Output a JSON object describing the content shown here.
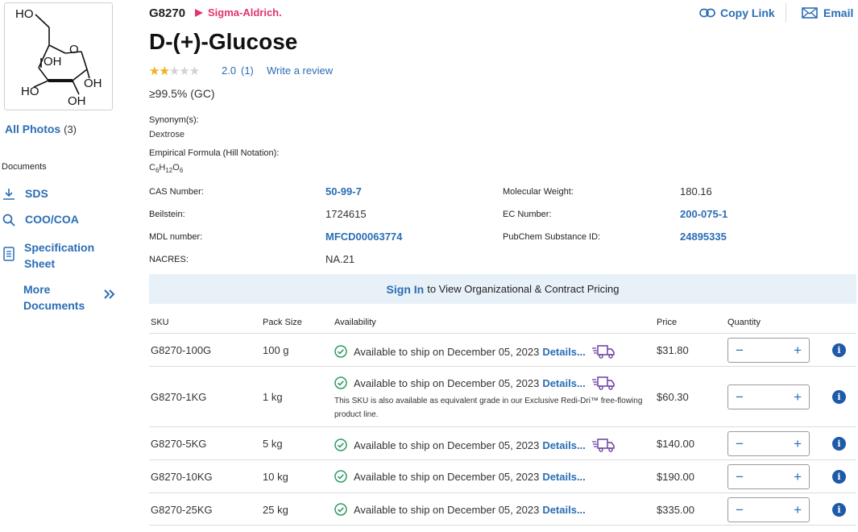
{
  "photos": {
    "label": "All Photos",
    "count": "(3)"
  },
  "documents": {
    "heading": "Documents",
    "items": [
      "SDS",
      "COO/COA"
    ],
    "spec_line1": "Specification",
    "spec_line2": "Sheet",
    "more_line1": "More",
    "more_line2": "Documents"
  },
  "header": {
    "sku": "G8270",
    "brand": "Sigma-Aldrich.",
    "title": "D-(+)-Glucose",
    "rating": 2.0,
    "rating_text": "2.0",
    "review_count": "(1)",
    "write_review": "Write a review",
    "purity": "≥99.5% (GC)",
    "copy_link": "Copy Link",
    "email": "Email"
  },
  "synonyms": {
    "label": "Synonym(s):",
    "value": "Dextrose"
  },
  "formula": {
    "label": "Empirical Formula (Hill Notation):",
    "c": "C",
    "c_sub": "6",
    "h": "H",
    "h_sub": "12",
    "o": "O",
    "o_sub": "6"
  },
  "properties": {
    "cas_label": "CAS Number:",
    "cas": "50-99-7",
    "mw_label": "Molecular Weight:",
    "mw": "180.16",
    "beilstein_label": "Beilstein:",
    "beilstein": "1724615",
    "ec_label": "EC Number:",
    "ec": "200-075-1",
    "mdl_label": "MDL number:",
    "mdl": "MFCD00063774",
    "pubchem_label": "PubChem Substance ID:",
    "pubchem": "24895335",
    "nacres_label": "NACRES:",
    "nacres": "NA.21"
  },
  "banner": {
    "sign_in": "Sign In",
    "text": "to View Organizational & Contract Pricing"
  },
  "table": {
    "headers": {
      "sku": "SKU",
      "pack": "Pack Size",
      "availability": "Availability",
      "price": "Price",
      "quantity": "Quantity"
    },
    "details_label": "Details...",
    "note": "This SKU is also available as equivalent grade in our Exclusive Redi-Dri™ free-flowing product line.",
    "rows": [
      {
        "sku": "G8270-100G",
        "pack": "100 g",
        "availability": "Available to ship on December 05, 2023",
        "price": "$31.80"
      },
      {
        "sku": "G8270-1KG",
        "pack": "1 kg",
        "availability": "Available to ship on December 05, 2023",
        "price": "$60.30"
      },
      {
        "sku": "G8270-5KG",
        "pack": "5 kg",
        "availability": "Available to ship on December 05, 2023",
        "price": "$140.00"
      },
      {
        "sku": "G8270-10KG",
        "pack": "10 kg",
        "availability": "Available to ship on December 05, 2023",
        "price": "$190.00"
      },
      {
        "sku": "G8270-25KG",
        "pack": "25 kg",
        "availability": "Available to ship on December 05, 2023",
        "price": "$335.00"
      }
    ]
  },
  "structure_labels": {
    "ho_top": "HO",
    "oh_inner": "OH",
    "oh_right": "OH",
    "ho_left": "HO",
    "oh_bottom": "OH",
    "ring_o": "O"
  },
  "colors": {
    "link": "#2a6db5",
    "brand": "#e2356a",
    "banner_bg": "#e9f1f8",
    "check": "#2e9a63",
    "truck": "#6b3fa0",
    "star": "#f2b01e"
  }
}
